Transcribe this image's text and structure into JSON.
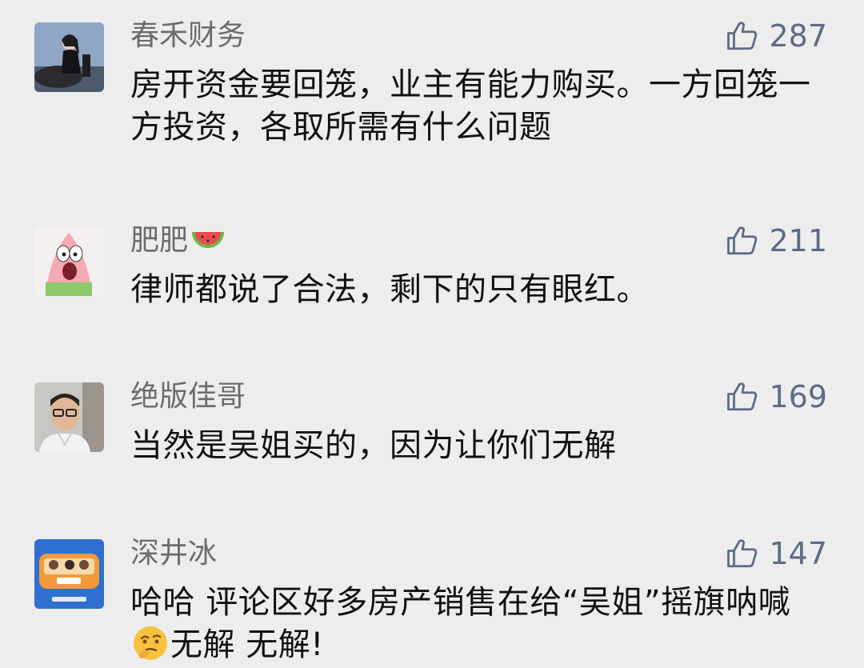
{
  "colors": {
    "background": "#ededed",
    "username": "#6c6c6c",
    "like_count": "#5f6b84",
    "comment_text": "#111111"
  },
  "comments": [
    {
      "username": "春禾财务",
      "likes": "287",
      "text": "房开资金要回笼，业主有能力购买。一方回笼一方投资，各取所需有什么问题",
      "avatar_icon": "avatar-woman-on-horse"
    },
    {
      "username": "肥肥",
      "username_emoji": "watermelon-icon",
      "likes": "211",
      "text": "律师都说了合法，剩下的只有眼红。",
      "avatar_icon": "avatar-cartoon-starfish"
    },
    {
      "username": "绝版佳哥",
      "likes": "169",
      "text": "当然是吴姐买的，因为让你们无解",
      "avatar_icon": "avatar-man-with-glasses"
    },
    {
      "username": "深井冰",
      "likes": "147",
      "text_part1": "哈哈 评论区好多房产销售在给“吴姐”摇旗呐喊",
      "text_emoji": "thinking-face-icon",
      "text_part2": "无解 无解!",
      "avatar_icon": "avatar-cartoon-family-car"
    }
  ]
}
